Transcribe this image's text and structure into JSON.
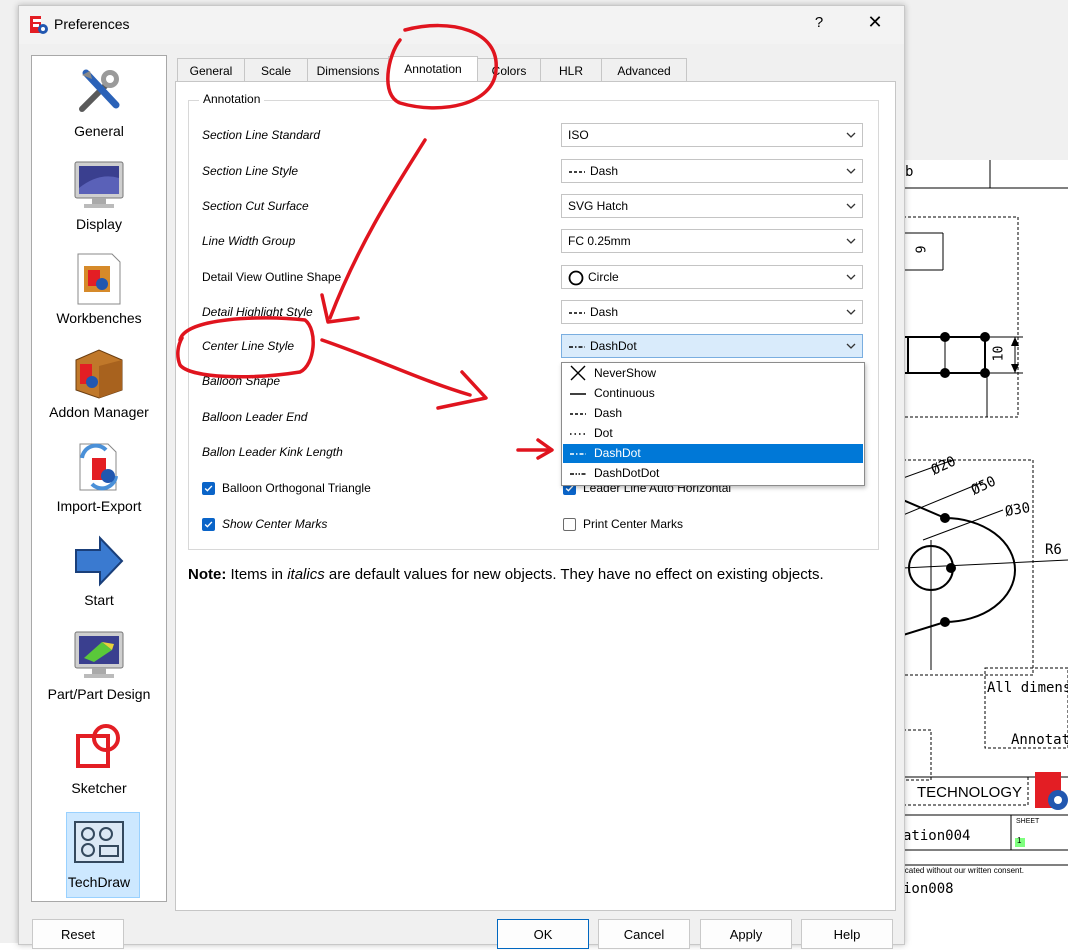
{
  "window": {
    "title": "Preferences",
    "help": "?",
    "close": "✕"
  },
  "sidebar": {
    "items": [
      {
        "label": "General",
        "icon": "tools-icon"
      },
      {
        "label": "Display",
        "icon": "monitor-icon"
      },
      {
        "label": "Workbenches",
        "icon": "workbench-document-icon"
      },
      {
        "label": "Addon Manager",
        "icon": "addon-box-icon"
      },
      {
        "label": "Import-Export",
        "icon": "import-export-icon"
      },
      {
        "label": "Start",
        "icon": "start-arrow-icon"
      },
      {
        "label": "Part/Part Design",
        "icon": "part-design-icon"
      },
      {
        "label": "Sketcher",
        "icon": "sketcher-icon"
      },
      {
        "label": "TechDraw",
        "icon": "techdraw-icon",
        "selected": true
      }
    ]
  },
  "tabs": [
    {
      "label": "General"
    },
    {
      "label": "Scale"
    },
    {
      "label": "Dimensions"
    },
    {
      "label": "Annotation",
      "active": true
    },
    {
      "label": "Colors"
    },
    {
      "label": "HLR"
    },
    {
      "label": "Advanced"
    }
  ],
  "annotation": {
    "group_title": "Annotation",
    "rows": [
      {
        "label": "Section Line Standard",
        "italic": true,
        "value": "ISO",
        "symbol": ""
      },
      {
        "label": "Section Line Style",
        "italic": true,
        "value": "Dash",
        "symbol": "dash"
      },
      {
        "label": "Section Cut Surface",
        "italic": true,
        "value": "SVG Hatch",
        "symbol": ""
      },
      {
        "label": "Line Width Group",
        "italic": true,
        "value": "FC 0.25mm",
        "symbol": ""
      },
      {
        "label": "Detail View Outline Shape",
        "italic": false,
        "value": "Circle",
        "symbol": "circle"
      },
      {
        "label": "Detail Highlight Style",
        "italic": true,
        "value": "Dash",
        "symbol": "dash"
      },
      {
        "label": "Center Line Style",
        "italic": true,
        "value": "DashDot",
        "symbol": "dashdot"
      },
      {
        "label": "Balloon Shape",
        "italic": true
      },
      {
        "label": "Balloon Leader End",
        "italic": true
      },
      {
        "label": "Ballon Leader Kink Length",
        "italic": true
      }
    ],
    "checkboxes": {
      "balloon_orthogonal": {
        "label": "Balloon Orthogonal Triangle",
        "checked": true
      },
      "leader_auto_horizontal": {
        "label": "Leader Line Auto Horizontal",
        "checked": true
      },
      "show_center_marks": {
        "label": "Show Center Marks",
        "checked": true
      },
      "print_center_marks": {
        "label": "Print Center Marks",
        "checked": false
      }
    },
    "note_bold": "Note:",
    "note_pre": " Items in ",
    "note_italic": "italics",
    "note_post": " are default values for new objects. They have no effect on existing objects."
  },
  "dropdown": {
    "options": [
      {
        "label": "NeverShow",
        "symbol": "x"
      },
      {
        "label": "Continuous",
        "symbol": "continuous"
      },
      {
        "label": "Dash",
        "symbol": "dash"
      },
      {
        "label": "Dot",
        "symbol": "dot"
      },
      {
        "label": "DashDot",
        "symbol": "dashdot",
        "selected": true
      },
      {
        "label": "DashDotDot",
        "symbol": "dashdotdot"
      }
    ]
  },
  "buttons": {
    "reset": "Reset",
    "ok": "OK",
    "cancel": "Cancel",
    "apply": "Apply",
    "help": "Help"
  },
  "drawing": {
    "dim_9": "9",
    "dim_10": "10",
    "dim_20": "Ø20",
    "dim_50": "Ø50",
    "dim_30": "Ø30",
    "dim_r6": "R6",
    "text_all_dims": "All dimens",
    "text_annotat": "Annotat",
    "text_technology": "TECHNOLOGY",
    "text_sheet": "SHEET",
    "text_sheet_num": "1",
    "text_ation004": "ation004",
    "text_consent": "icated without our written consent.",
    "text_ion008": "ion008",
    "text_header": "b"
  },
  "colors": {
    "accent": "#0078d7",
    "annotation_red": "#e0141e",
    "selection_bg": "#cde8ff"
  }
}
